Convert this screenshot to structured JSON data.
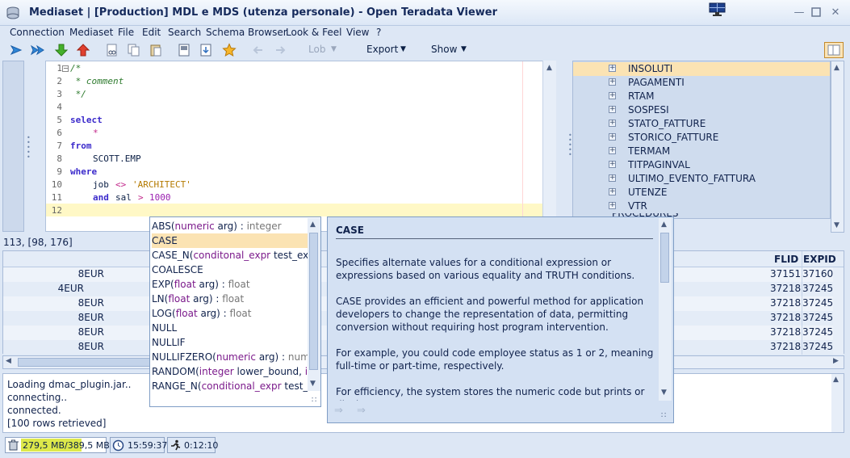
{
  "window": {
    "title": "Mediaset | [Production] MDL e MDS (utenza personale) - Open Teradata Viewer"
  },
  "menu": [
    "Connection",
    "Mediaset",
    "File",
    "Edit",
    "Search",
    "Schema Browser",
    "Look & Feel",
    "View",
    "?"
  ],
  "toolbar": {
    "lob": "Lob",
    "export": "Export",
    "show": "Show"
  },
  "editor": {
    "lines": [
      "1",
      "2",
      "3",
      "4",
      "5",
      "6",
      "7",
      "8",
      "9",
      "10",
      "11",
      "12"
    ],
    "code": {
      "l1": "/*",
      "l2": " * comment",
      "l3": " */",
      "l5": "select",
      "l6": "*",
      "l7": "from",
      "l8": "SCOTT.EMP",
      "l9": "where",
      "l10a": "job",
      "l10b": "<>",
      "l10c": "'ARCHITECT'",
      "l11a": "and",
      "l11b": "sal",
      "l11c": ">",
      "l11d": "1000"
    }
  },
  "tree": {
    "items": [
      "INSOLUTI",
      "PAGAMENTI",
      "RTAM",
      "SOSPESI",
      "STATO_FATTURE",
      "STORICO_FATTURE",
      "TERMAM",
      "TITPAGINVAL",
      "ULTIMO_EVENTO_FATTURA",
      "UTENZE",
      "VTR"
    ],
    "partial": "PROCEDURES"
  },
  "cursor_position": "113, [98, 176]",
  "grid": {
    "headers": [
      "FLID",
      "EXPID"
    ],
    "rows": [
      [
        "8EUR",
        "37151",
        "37160"
      ],
      [
        "4EUR",
        "37218",
        "37245"
      ],
      [
        "8EUR",
        "37218",
        "37245"
      ],
      [
        "8EUR",
        "37218",
        "37245"
      ],
      [
        "8EUR",
        "37218",
        "37245"
      ],
      [
        "8EUR",
        "37218",
        "37245"
      ]
    ]
  },
  "console": [
    "Loading dmac_plugin.jar..",
    "connecting..",
    "connected.",
    "[100 rows retrieved]"
  ],
  "status": {
    "memory": "279,5 MB/389,5 MB",
    "memory_fraction": 0.72,
    "clock": "15:59:37",
    "elapsed": "0:12:10"
  },
  "autocomplete": [
    {
      "name": "ABS(",
      "ptype": "numeric",
      "rest": " arg) : ",
      "ret": "integer"
    },
    {
      "name": "CASE",
      "ptype": "",
      "rest": "",
      "ret": ""
    },
    {
      "name": "CASE_N(",
      "ptype": "conditonal_expr",
      "rest": " test_express",
      "ret": ""
    },
    {
      "name": "COALESCE",
      "ptype": "",
      "rest": "",
      "ret": ""
    },
    {
      "name": "EXP(",
      "ptype": "float",
      "rest": " arg) : ",
      "ret": "float"
    },
    {
      "name": "LN(",
      "ptype": "float",
      "rest": " arg) : ",
      "ret": "float"
    },
    {
      "name": "LOG(",
      "ptype": "float",
      "rest": " arg) : ",
      "ret": "float"
    },
    {
      "name": "NULL",
      "ptype": "",
      "rest": "",
      "ret": ""
    },
    {
      "name": "NULLIF",
      "ptype": "",
      "rest": "",
      "ret": ""
    },
    {
      "name": "NULLIFZERO(",
      "ptype": "numeric",
      "rest": " arg) : ",
      "ret": "numeric"
    },
    {
      "name": "RANDOM(",
      "ptype": "integer",
      "rest": " lower_bound, ",
      "ret": "inte"
    },
    {
      "name": "RANGE_N(",
      "ptype": "conditional_expr",
      "rest": " test_expr",
      "ret": ""
    }
  ],
  "doc": {
    "title": "CASE",
    "p1": "Specifies alternate values for a conditional expression or expressions based on various equality and TRUTH conditions.",
    "p2": "CASE provides an efficient and powerful method for application developers to change the representation of data, permitting conversion without requiring host program intervention.",
    "p3": "For example, you could code employee status as 1 or 2, meaning full-time or part-time, respectively.",
    "p4": "For efficiency, the system stores the numeric code but prints or displays"
  }
}
